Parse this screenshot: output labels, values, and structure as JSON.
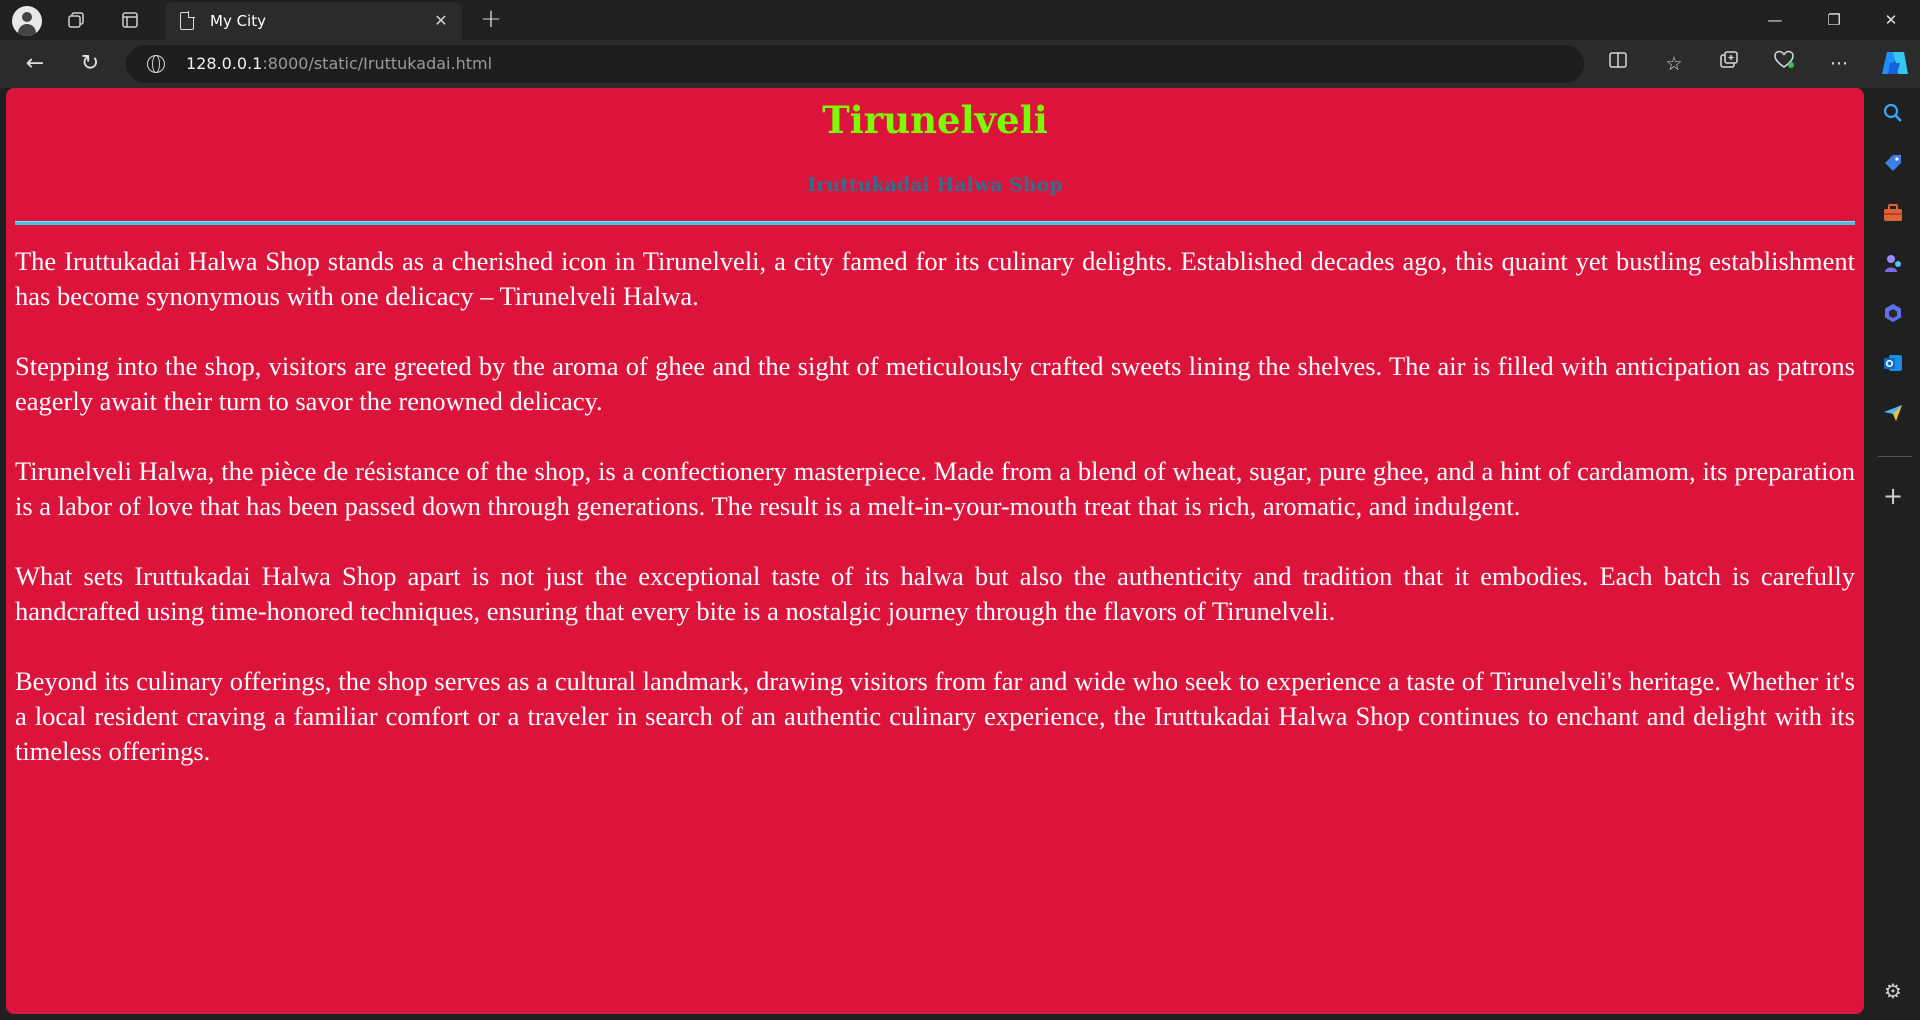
{
  "browser": {
    "tab_title": "My City",
    "url_host": "128.0.0.1",
    "url_rest": ":8000/static/Iruttukadai.html"
  },
  "page": {
    "title": "Tirunelveli",
    "subtitle": "Iruttukadai Halwa Shop",
    "paragraphs": [
      "The Iruttukadai Halwa Shop stands as a cherished icon in Tirunelveli, a city famed for its culinary delights. Established decades ago, this quaint yet bustling establishment has become synonymous with one delicacy – Tirunelveli Halwa.",
      "Stepping into the shop, visitors are greeted by the aroma of ghee and the sight of meticulously crafted sweets lining the shelves. The air is filled with anticipation as patrons eagerly await their turn to savor the renowned delicacy.",
      "Tirunelveli Halwa, the pièce de résistance of the shop, is a confectionery masterpiece. Made from a blend of wheat, sugar, pure ghee, and a hint of cardamom, its preparation is a labor of love that has been passed down through generations. The result is a melt-in-your-mouth treat that is rich, aromatic, and indulgent.",
      "What sets Iruttukadai Halwa Shop apart is not just the exceptional taste of its halwa but also the authenticity and tradition that it embodies. Each batch is carefully handcrafted using time-honored techniques, ensuring that every bite is a nostalgic journey through the flavors of Tirunelveli.",
      "Beyond its culinary offerings, the shop serves as a cultural landmark, drawing visitors from far and wide who seek to experience a taste of Tirunelveli's heritage. Whether it's a local resident craving a familiar comfort or a traveler in search of an authentic culinary experience, the Iruttukadai Halwa Shop continues to enchant and delight with its timeless offerings."
    ]
  },
  "colors": {
    "page_background": "#dc143c",
    "title": "#7cfc00",
    "subtitle": "#2f6f8f",
    "divider": "#40c4e8",
    "body_text": "#ffffff"
  },
  "icons": {
    "tabstrip": [
      "profile-icon",
      "workspaces-icon",
      "tab-actions-icon",
      "page-icon",
      "close-icon",
      "new-tab-icon"
    ],
    "toolbar": [
      "back-icon",
      "refresh-icon",
      "globe-icon",
      "split-screen-icon",
      "favorites-icon",
      "collections-icon",
      "performance-icon",
      "more-icon",
      "copilot-icon"
    ],
    "sidebar": [
      "search-icon",
      "shopping-icon",
      "tools-icon",
      "games-icon",
      "microsoft-365-icon",
      "outlook-icon",
      "send-icon",
      "add-icon",
      "settings-icon"
    ]
  }
}
